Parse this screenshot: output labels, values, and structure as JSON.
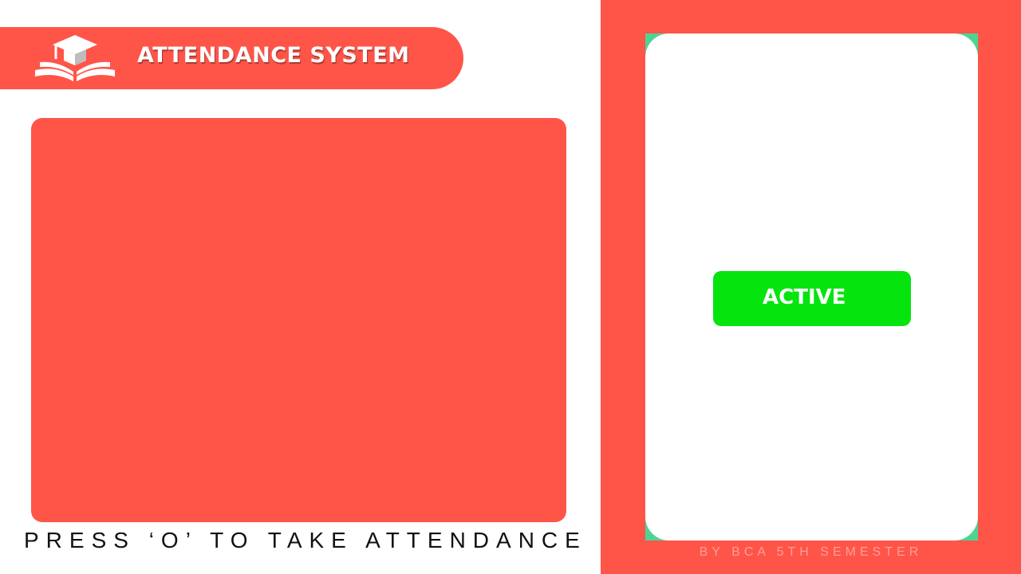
{
  "header": {
    "title": "ATTENDANCE SYSTEM",
    "logo_icon": "graduation-cap-book-icon"
  },
  "camera": {
    "instruction": "PRESS ‘O’ TO TAKE ATTENDANCE"
  },
  "status_panel": {
    "status_label": "ACTIVE",
    "credit": "BY BCA 5TH SEMESTER"
  },
  "colors": {
    "brand": "#ff5549",
    "active": "#06e40e",
    "card_accent": "#4fd393",
    "credit_text": "#ff9f98"
  }
}
